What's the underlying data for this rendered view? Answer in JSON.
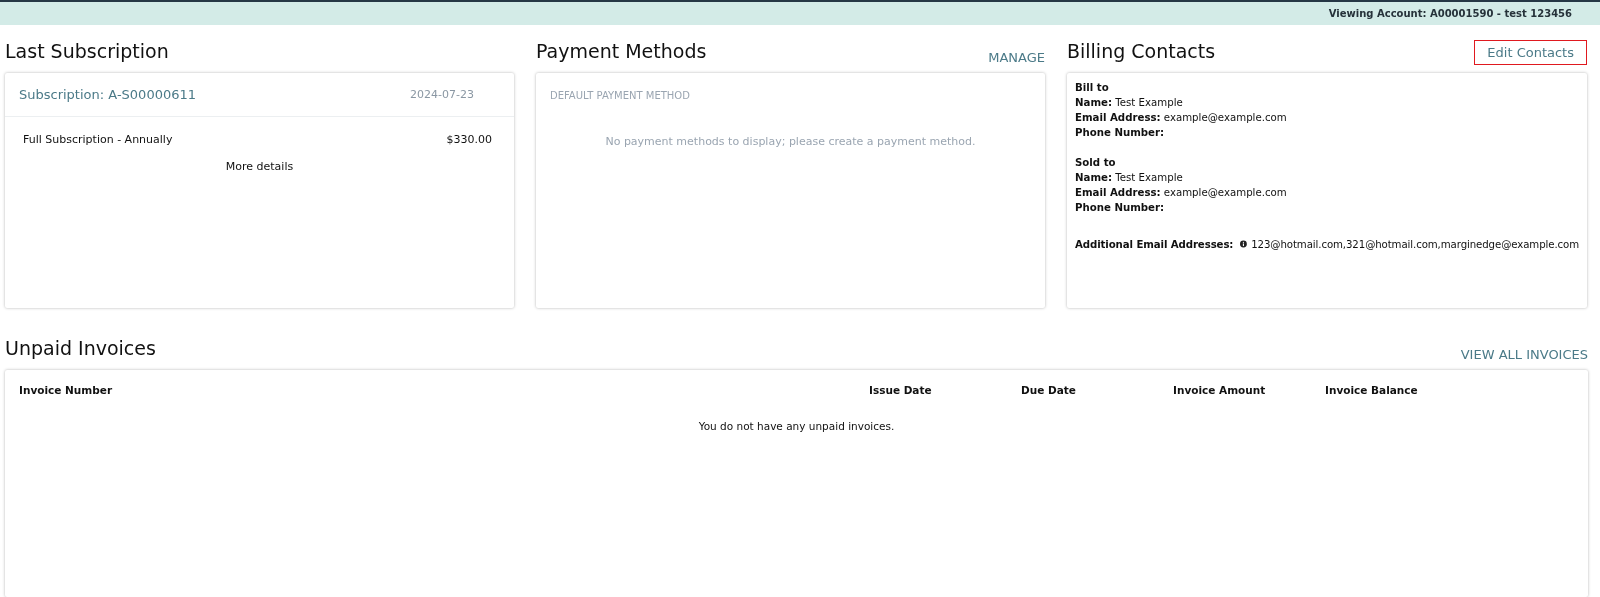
{
  "top_bar": {
    "account": "Viewing Account: A00001590 - test 123456"
  },
  "last_subscription": {
    "title": "Last Subscription",
    "subscription": "Subscription: A-S00000611",
    "date": "2024-07-23",
    "lines": [
      {
        "name": "Full Subscription - Annually",
        "amount": "$330.00"
      }
    ],
    "more": "More details"
  },
  "payment_methods": {
    "title": "Payment Methods",
    "action": "MANAGE",
    "label": "DEFAULT PAYMENT METHOD",
    "empty": "No payment methods to display; please create a payment method."
  },
  "billing_contacts": {
    "title": "Billing Contacts",
    "action": {
      "label": "Edit Contacts",
      "highlighted": true
    },
    "groups": [
      {
        "heading": "Bill to",
        "lines": [
          "**Name:** Test Example",
          "**Email Address:** example@example.com",
          "**Phone Number:**"
        ]
      },
      {
        "heading": "Sold to",
        "lines": [
          "**Name:** Test Example",
          "**Email Address:** example@example.com",
          "**Phone Number:**"
        ]
      }
    ],
    "additional": {
      "label": "Additional Email Addresses:",
      "value": "123@hotmail.com,321@hotmail.com,marginedge@example.com"
    }
  },
  "unpaid_invoices": {
    "title": "Unpaid Invoices",
    "action": "VIEW ALL INVOICES",
    "columns": [
      "Invoice Number",
      "Issue Date",
      "Due Date",
      "Invoice Amount",
      "Invoice Balance"
    ],
    "empty": "You do not have any unpaid invoices."
  }
}
